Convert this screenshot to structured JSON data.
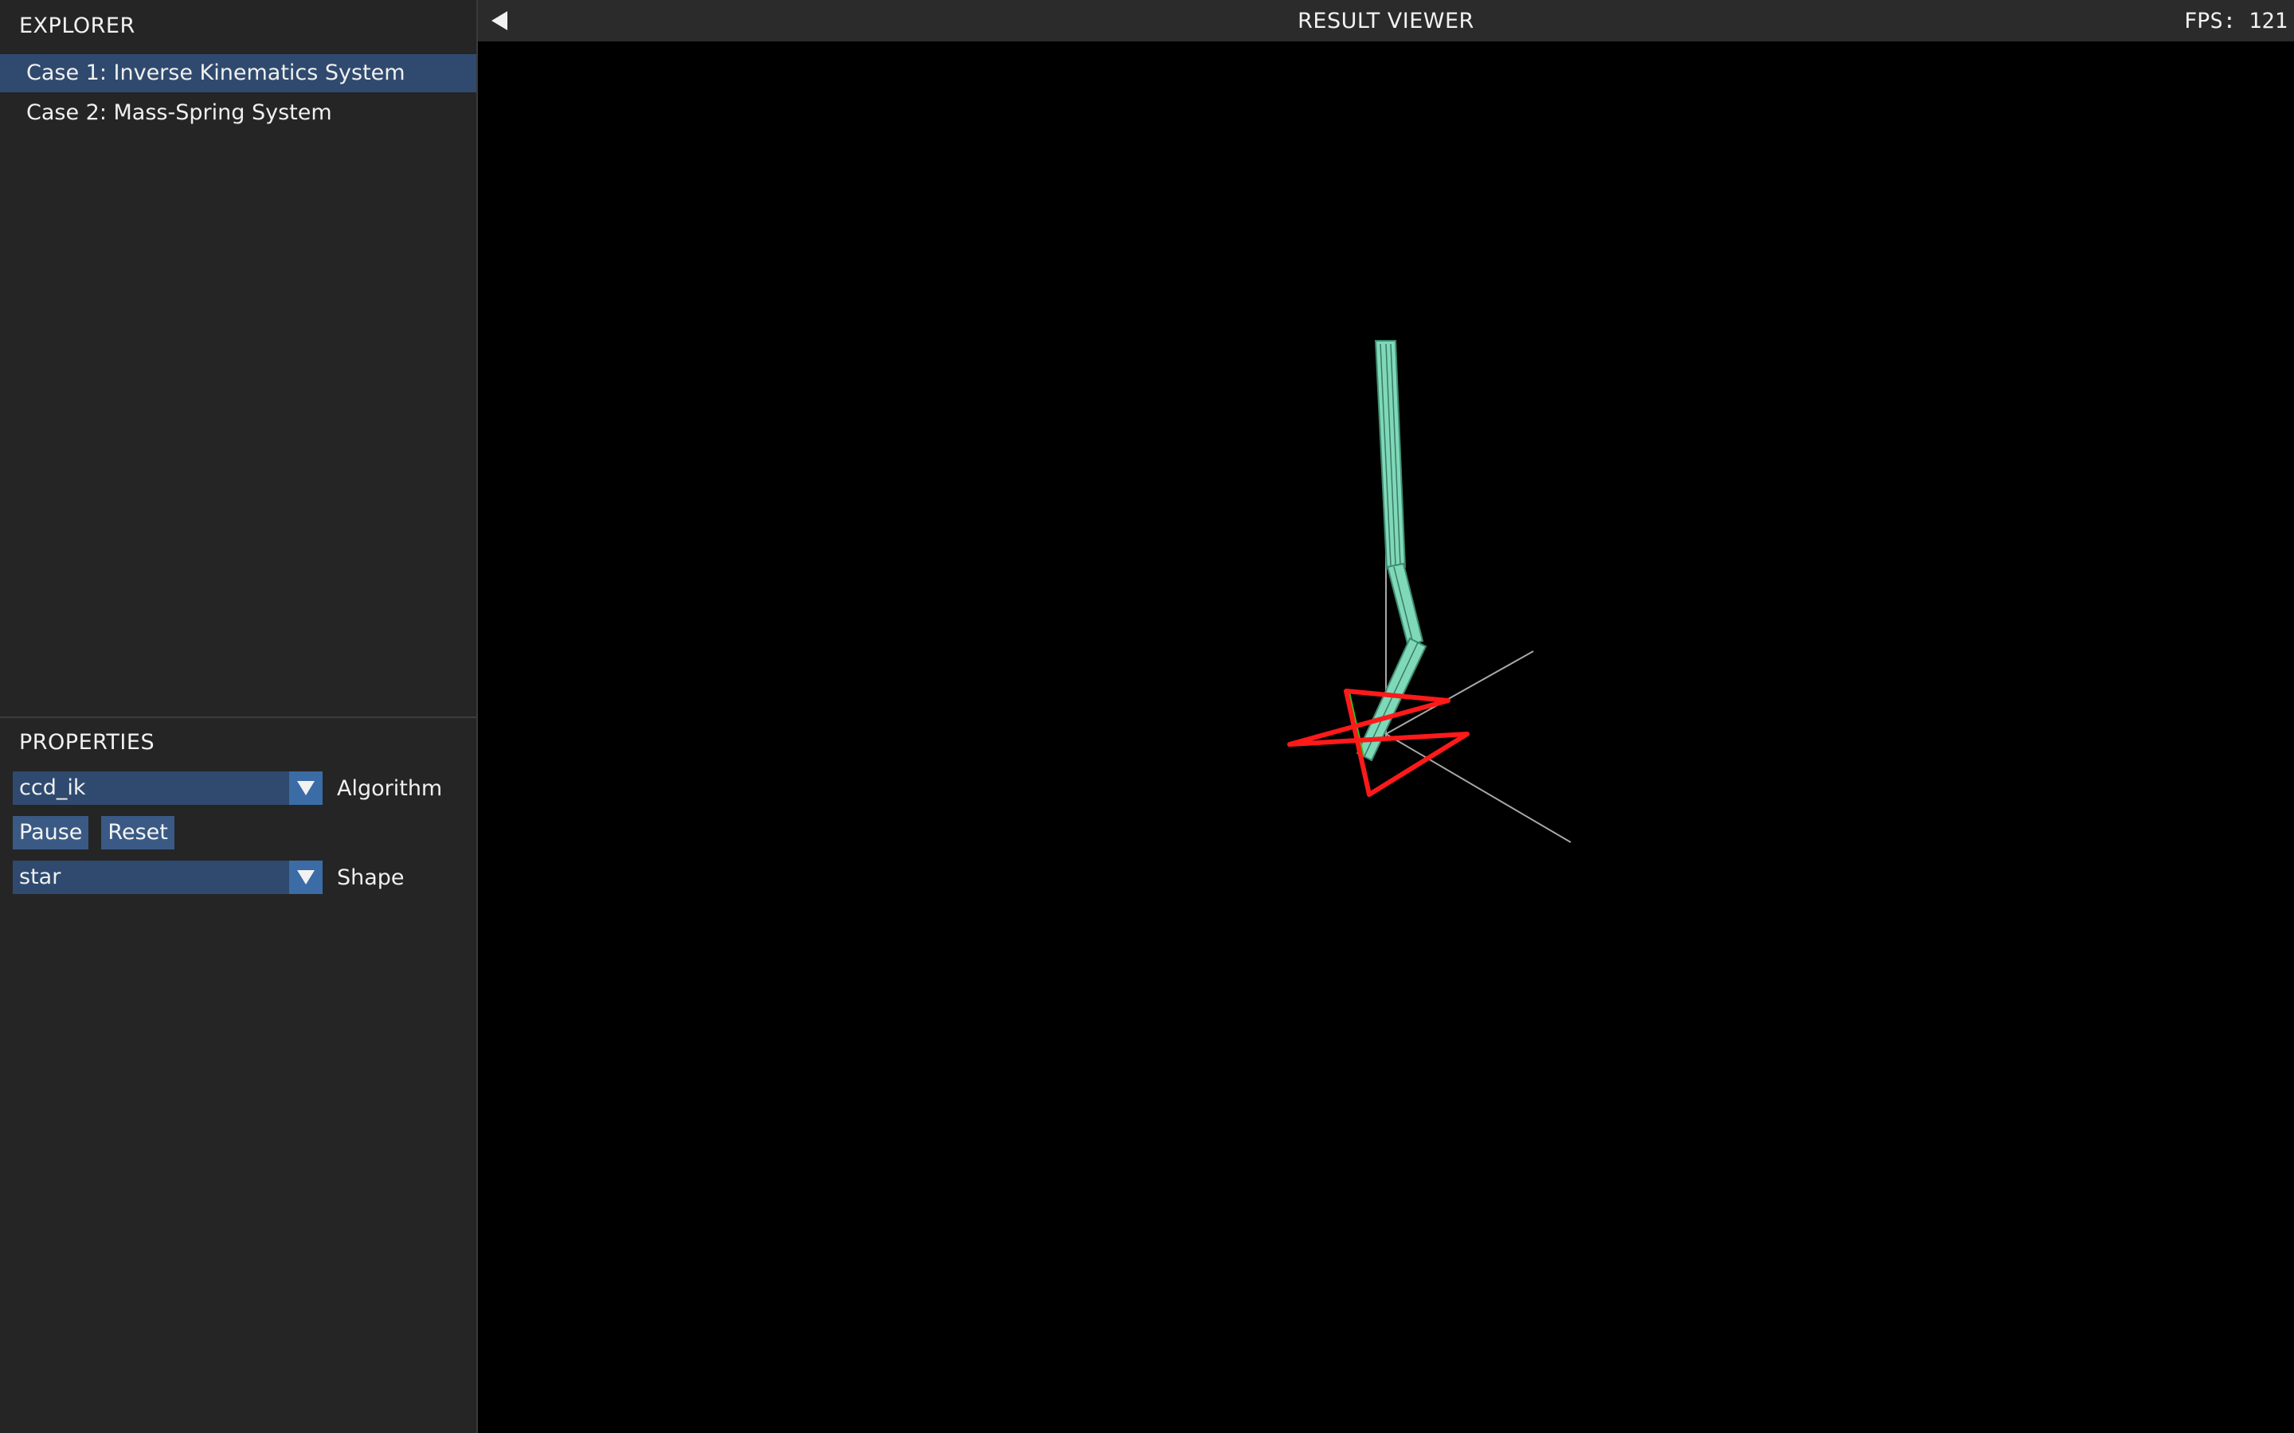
{
  "explorer": {
    "title": "EXPLORER",
    "items": [
      {
        "label": "Case 1: Inverse Kinematics System",
        "selected": true
      },
      {
        "label": "Case 2: Mass-Spring System",
        "selected": false
      }
    ]
  },
  "properties": {
    "title": "PROPERTIES",
    "algorithm": {
      "value": "ccd_ik",
      "label": "Algorithm"
    },
    "pause_label": "Pause",
    "reset_label": "Reset",
    "shape": {
      "value": "star",
      "label": "Shape"
    }
  },
  "viewer": {
    "title": "RESULT VIEWER",
    "fps": "FPS: 121",
    "collapse_icon": "triangle-left-icon"
  },
  "colors": {
    "panel_bg": "#252525",
    "selection": "#2f4a6e",
    "button": "#3a5a85",
    "combo_arrow": "#3b6ca6",
    "viewport_bg": "#000000",
    "star": "#ff1a1a",
    "arm": "#7fd9b8"
  }
}
